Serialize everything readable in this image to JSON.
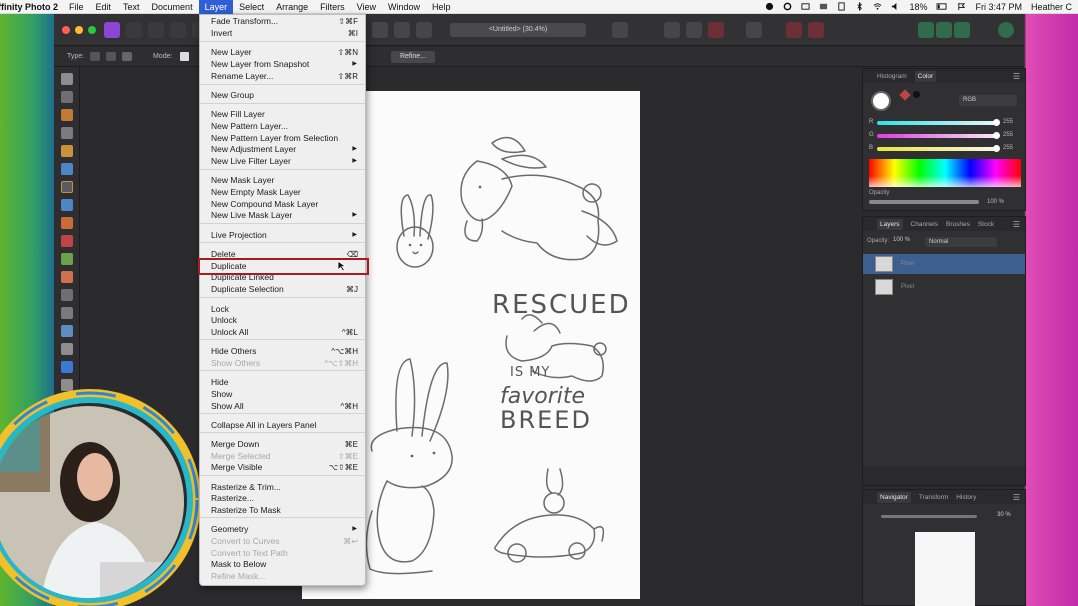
{
  "menubar": {
    "app_name": "ffinity Photo 2",
    "menus": [
      "File",
      "Edit",
      "Text",
      "Document",
      "Layer",
      "Select",
      "Arrange",
      "Filters",
      "View",
      "Window",
      "Help"
    ],
    "battery": "18%",
    "clock": "Fri 3:47 PM",
    "user": "Heather C"
  },
  "toolbar": {
    "doc_title": "<Untitled> (30.4%)"
  },
  "contextbar": {
    "type_label": "Type:",
    "mode_label": "Mode:",
    "refine_label": "Refine..."
  },
  "layer_menu": {
    "items": [
      {
        "label": "Fade Transform...",
        "shortcut": "⇧⌘F",
        "submenu": false,
        "enabled": true
      },
      {
        "label": "Invert",
        "shortcut": "⌘I",
        "submenu": false,
        "enabled": true
      },
      {
        "label": "New Layer",
        "shortcut": "⇧⌘N",
        "submenu": false,
        "enabled": true
      },
      {
        "label": "New Layer from Snapshot",
        "shortcut": "",
        "submenu": true,
        "enabled": true
      },
      {
        "label": "Rename Layer...",
        "shortcut": "⇧⌘R",
        "submenu": false,
        "enabled": true
      },
      {
        "label": "New Group",
        "shortcut": "",
        "submenu": false,
        "enabled": true
      },
      {
        "label": "New Fill Layer",
        "shortcut": "",
        "submenu": false,
        "enabled": true
      },
      {
        "label": "New Pattern Layer...",
        "shortcut": "",
        "submenu": false,
        "enabled": true
      },
      {
        "label": "New Pattern Layer from Selection",
        "shortcut": "",
        "submenu": false,
        "enabled": true
      },
      {
        "label": "New Adjustment Layer",
        "shortcut": "",
        "submenu": true,
        "enabled": true
      },
      {
        "label": "New Live Filter Layer",
        "shortcut": "",
        "submenu": true,
        "enabled": true
      },
      {
        "label": "New Mask Layer",
        "shortcut": "",
        "submenu": false,
        "enabled": true
      },
      {
        "label": "New Empty Mask Layer",
        "shortcut": "",
        "submenu": false,
        "enabled": true
      },
      {
        "label": "New Compound Mask Layer",
        "shortcut": "",
        "submenu": false,
        "enabled": true
      },
      {
        "label": "New Live Mask Layer",
        "shortcut": "",
        "submenu": true,
        "enabled": true
      },
      {
        "label": "Live Projection",
        "shortcut": "",
        "submenu": true,
        "enabled": true
      },
      {
        "label": "Delete",
        "shortcut": "⌫",
        "submenu": false,
        "enabled": true
      },
      {
        "label": "Duplicate",
        "shortcut": "",
        "submenu": false,
        "enabled": true
      },
      {
        "label": "Duplicate Linked",
        "shortcut": "",
        "submenu": false,
        "enabled": true
      },
      {
        "label": "Duplicate Selection",
        "shortcut": "⌘J",
        "submenu": false,
        "enabled": true
      },
      {
        "label": "Lock",
        "shortcut": "",
        "submenu": false,
        "enabled": true
      },
      {
        "label": "Unlock",
        "shortcut": "",
        "submenu": false,
        "enabled": true
      },
      {
        "label": "Unlock All",
        "shortcut": "^⌘L",
        "submenu": false,
        "enabled": true
      },
      {
        "label": "Hide Others",
        "shortcut": "^⌥⌘H",
        "submenu": false,
        "enabled": true
      },
      {
        "label": "Show Others",
        "shortcut": "^⌥⇧⌘H",
        "submenu": false,
        "enabled": false
      },
      {
        "label": "Hide",
        "shortcut": "",
        "submenu": false,
        "enabled": true
      },
      {
        "label": "Show",
        "shortcut": "",
        "submenu": false,
        "enabled": true
      },
      {
        "label": "Show All",
        "shortcut": "^⌘H",
        "submenu": false,
        "enabled": true
      },
      {
        "label": "Collapse All in Layers Panel",
        "shortcut": "",
        "submenu": false,
        "enabled": true
      },
      {
        "label": "Merge Down",
        "shortcut": "⌘E",
        "submenu": false,
        "enabled": true
      },
      {
        "label": "Merge Selected",
        "shortcut": "⇧⌘E",
        "submenu": false,
        "enabled": false
      },
      {
        "label": "Merge Visible",
        "shortcut": "⌥⇧⌘E",
        "submenu": false,
        "enabled": true
      },
      {
        "label": "Rasterize & Trim...",
        "shortcut": "",
        "submenu": false,
        "enabled": true
      },
      {
        "label": "Rasterize...",
        "shortcut": "",
        "submenu": false,
        "enabled": true
      },
      {
        "label": "Rasterize To Mask",
        "shortcut": "",
        "submenu": false,
        "enabled": true
      },
      {
        "label": "Geometry",
        "shortcut": "",
        "submenu": true,
        "enabled": true
      },
      {
        "label": "Convert to Curves",
        "shortcut": "⌘↩",
        "submenu": false,
        "enabled": false
      },
      {
        "label": "Convert to Text Path",
        "shortcut": "",
        "submenu": false,
        "enabled": false
      },
      {
        "label": "Mask to Below",
        "shortcut": "",
        "submenu": false,
        "enabled": true
      },
      {
        "label": "Refine Mask...",
        "shortcut": "",
        "submenu": false,
        "enabled": false
      }
    ]
  },
  "color_panel": {
    "tabs": [
      "Histogram",
      "Color"
    ],
    "mode": "RGB",
    "r": "255",
    "g": "255",
    "b": "255",
    "opacity_label": "Opacity",
    "opacity_value": "100 %"
  },
  "layers_panel": {
    "tabs": [
      "Layers",
      "Channels",
      "Brushes",
      "Stock"
    ],
    "opacity_label": "Opacity:",
    "opacity_value": "100 %",
    "blend_mode": "Normal",
    "layers": [
      {
        "name": "Pixel",
        "selected": true
      },
      {
        "name": "Pixel",
        "selected": false
      }
    ]
  },
  "navigator_panel": {
    "tabs": [
      "Navigator",
      "Transform",
      "History"
    ],
    "zoom": "30 %"
  },
  "canvas_art": {
    "word1": "RESCUED",
    "word2": "IS MY",
    "word3": "favorite",
    "word4": "BREED"
  },
  "colors": {
    "menu_highlight": "#2f5fd6",
    "annotation_box": "#a51d22",
    "selected_layer": "#3d5f8f"
  }
}
